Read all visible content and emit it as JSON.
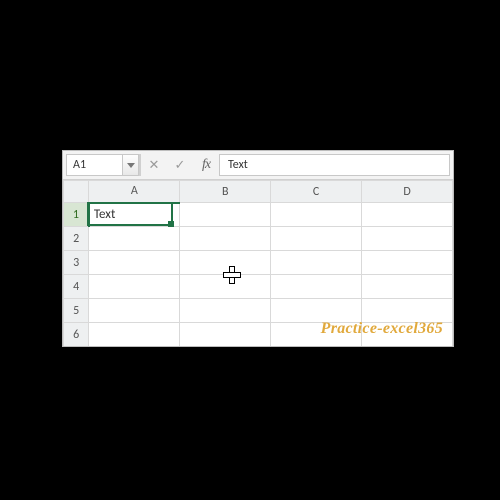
{
  "formula_bar": {
    "name_box": "A1",
    "cancel_glyph": "✕",
    "enter_glyph": "✓",
    "fx_label": "fx",
    "value": "Text"
  },
  "columns": [
    "A",
    "B",
    "C",
    "D"
  ],
  "rows": [
    "1",
    "2",
    "3",
    "4",
    "5",
    "6"
  ],
  "active_cell": {
    "col": "A",
    "row": "1"
  },
  "cells": {
    "A1": "Text"
  },
  "watermark": "Practice-excel365",
  "colors": {
    "selection": "#217346",
    "header_bg": "#eef0f1",
    "grid_line": "#d9d9d9",
    "watermark": "#e1a93c"
  }
}
